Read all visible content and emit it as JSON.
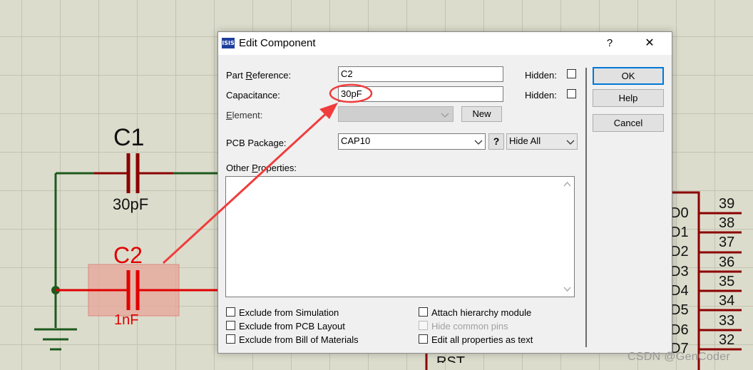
{
  "schematic": {
    "c1": {
      "ref": "C1",
      "value": "30pF"
    },
    "c2": {
      "ref": "C2",
      "value": "1nF"
    },
    "pins": [
      {
        "num": "39",
        "name": "D0"
      },
      {
        "num": "38",
        "name": "D1"
      },
      {
        "num": "37",
        "name": "D2"
      },
      {
        "num": "36",
        "name": "D3"
      },
      {
        "num": "35",
        "name": "D4"
      },
      {
        "num": "34",
        "name": "D5"
      },
      {
        "num": "33",
        "name": "D6"
      },
      {
        "num": "32",
        "name": "D7"
      }
    ],
    "partial_label": "RST"
  },
  "dialog": {
    "title": "Edit Component",
    "help_symbol": "?",
    "close_symbol": "✕",
    "app_icon_text": "ISIS",
    "fields": {
      "part_reference": {
        "label_pre": "Part ",
        "label_u": "R",
        "label_post": "eference:",
        "value": "C2",
        "hidden_label": "Hidden:"
      },
      "capacitance": {
        "label": "Capacitance:",
        "value": "30pF",
        "hidden_label": "Hidden:"
      },
      "element": {
        "label_u": "E",
        "label_post": "lement:",
        "value": "",
        "new_button": "New"
      },
      "pcb_package": {
        "label": "PCB Package:",
        "value": "CAP10",
        "help_button": "?",
        "visibility_value": "Hide All"
      },
      "other_properties": {
        "label_pre": "Other ",
        "label_u": "P",
        "label_post": "roperties:",
        "value": ""
      }
    },
    "buttons": {
      "ok": "OK",
      "help": "Help",
      "cancel": "Cancel"
    },
    "checkboxes": {
      "exclude_simulation": {
        "label": "Exclude from Simulation",
        "checked": false
      },
      "exclude_pcb": {
        "label": "Exclude from PCB Layout",
        "checked": false
      },
      "exclude_bom": {
        "label": "Exclude from Bill of Materials",
        "checked": false
      },
      "attach_hierarchy": {
        "label": "Attach hierarchy module",
        "checked": false
      },
      "hide_common_pins": {
        "label": "Hide common pins",
        "checked": false,
        "disabled": true
      },
      "edit_as_text": {
        "label": "Edit all properties as text",
        "checked": false
      }
    }
  },
  "annotation": {
    "color": "#f03c3c"
  },
  "watermark": "CSDN @GenCoder",
  "colors": {
    "wire_green": "#1e5a1e",
    "wire_red": "#e00000",
    "component_dark_red": "#8b0000",
    "selection": "#e8a49a",
    "accent": "#0078d7"
  }
}
